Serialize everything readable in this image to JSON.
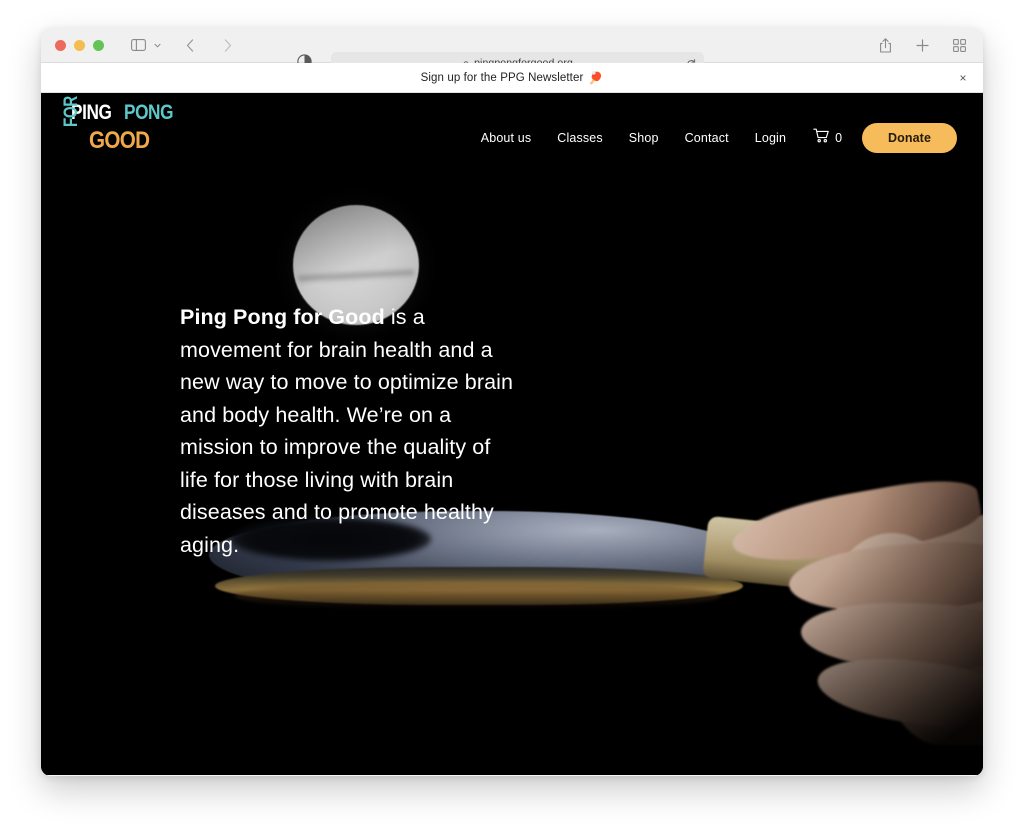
{
  "browser": {
    "name": "safari",
    "traffic_lights": [
      "close",
      "minimize",
      "zoom"
    ],
    "sidebar_label": "sidebar-toggle",
    "back_label": "back",
    "forward_label": "forward",
    "reader_label": "reader-view",
    "url": "pingpongforgood.org",
    "lock": "secure-lock",
    "reload_label": "reload",
    "share_label": "share",
    "new_tab_label": "new-tab",
    "tab_overview_label": "tab-overview"
  },
  "notification": {
    "text": "Sign up for the PPG Newsletter",
    "emoji": "🏓",
    "close_label": "×"
  },
  "site": {
    "logo": {
      "ping": "PING",
      "pong": "PONG",
      "for": "FOR",
      "good": "GOOD",
      "color_ping": "#ffffff",
      "color_pong": "#5fc7c9",
      "color_for": "#5fc7c9",
      "color_good": "#f0a84a"
    },
    "nav": [
      {
        "label": "About us"
      },
      {
        "label": "Classes"
      },
      {
        "label": "Shop"
      },
      {
        "label": "Contact"
      },
      {
        "label": "Login"
      }
    ],
    "cart": {
      "count": "0",
      "icon": "shopping-cart-icon"
    },
    "donate": {
      "label": "Donate",
      "bg": "#f6bb5a",
      "fg": "#231a08"
    },
    "hero": {
      "brand": "Ping Pong for Good",
      "body": " is a movement for brain health and a new way to move to optimize brain and body health. We’re on a mission to improve the quality of life for those living with brain diseases and to promote healthy aging.",
      "background": "Photograph of a white ping pong ball above a dark blue table tennis paddle held in a hand, on black",
      "text_color": "#ffffff",
      "bg_color": "#000000"
    }
  }
}
